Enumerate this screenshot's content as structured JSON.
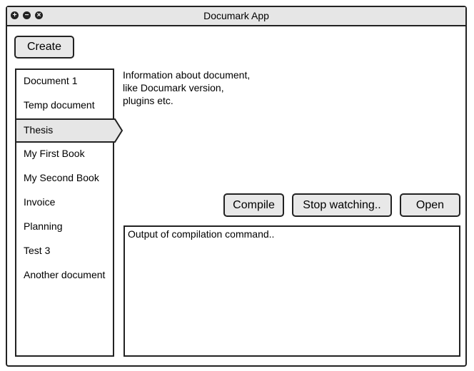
{
  "window": {
    "title": "Documark App"
  },
  "create_label": "Create",
  "documents": [
    "Document 1",
    "Temp document",
    "Thesis",
    "My First Book",
    "My Second Book",
    "Invoice",
    "Planning",
    "Test 3",
    "Another document"
  ],
  "selected": "Thesis",
  "info": [
    "Information about document,",
    "like Documark version,",
    "plugins etc."
  ],
  "buttons": {
    "compile": "Compile",
    "stop": "Stop watching..",
    "open": "Open"
  },
  "output": "Output of compilation command.."
}
